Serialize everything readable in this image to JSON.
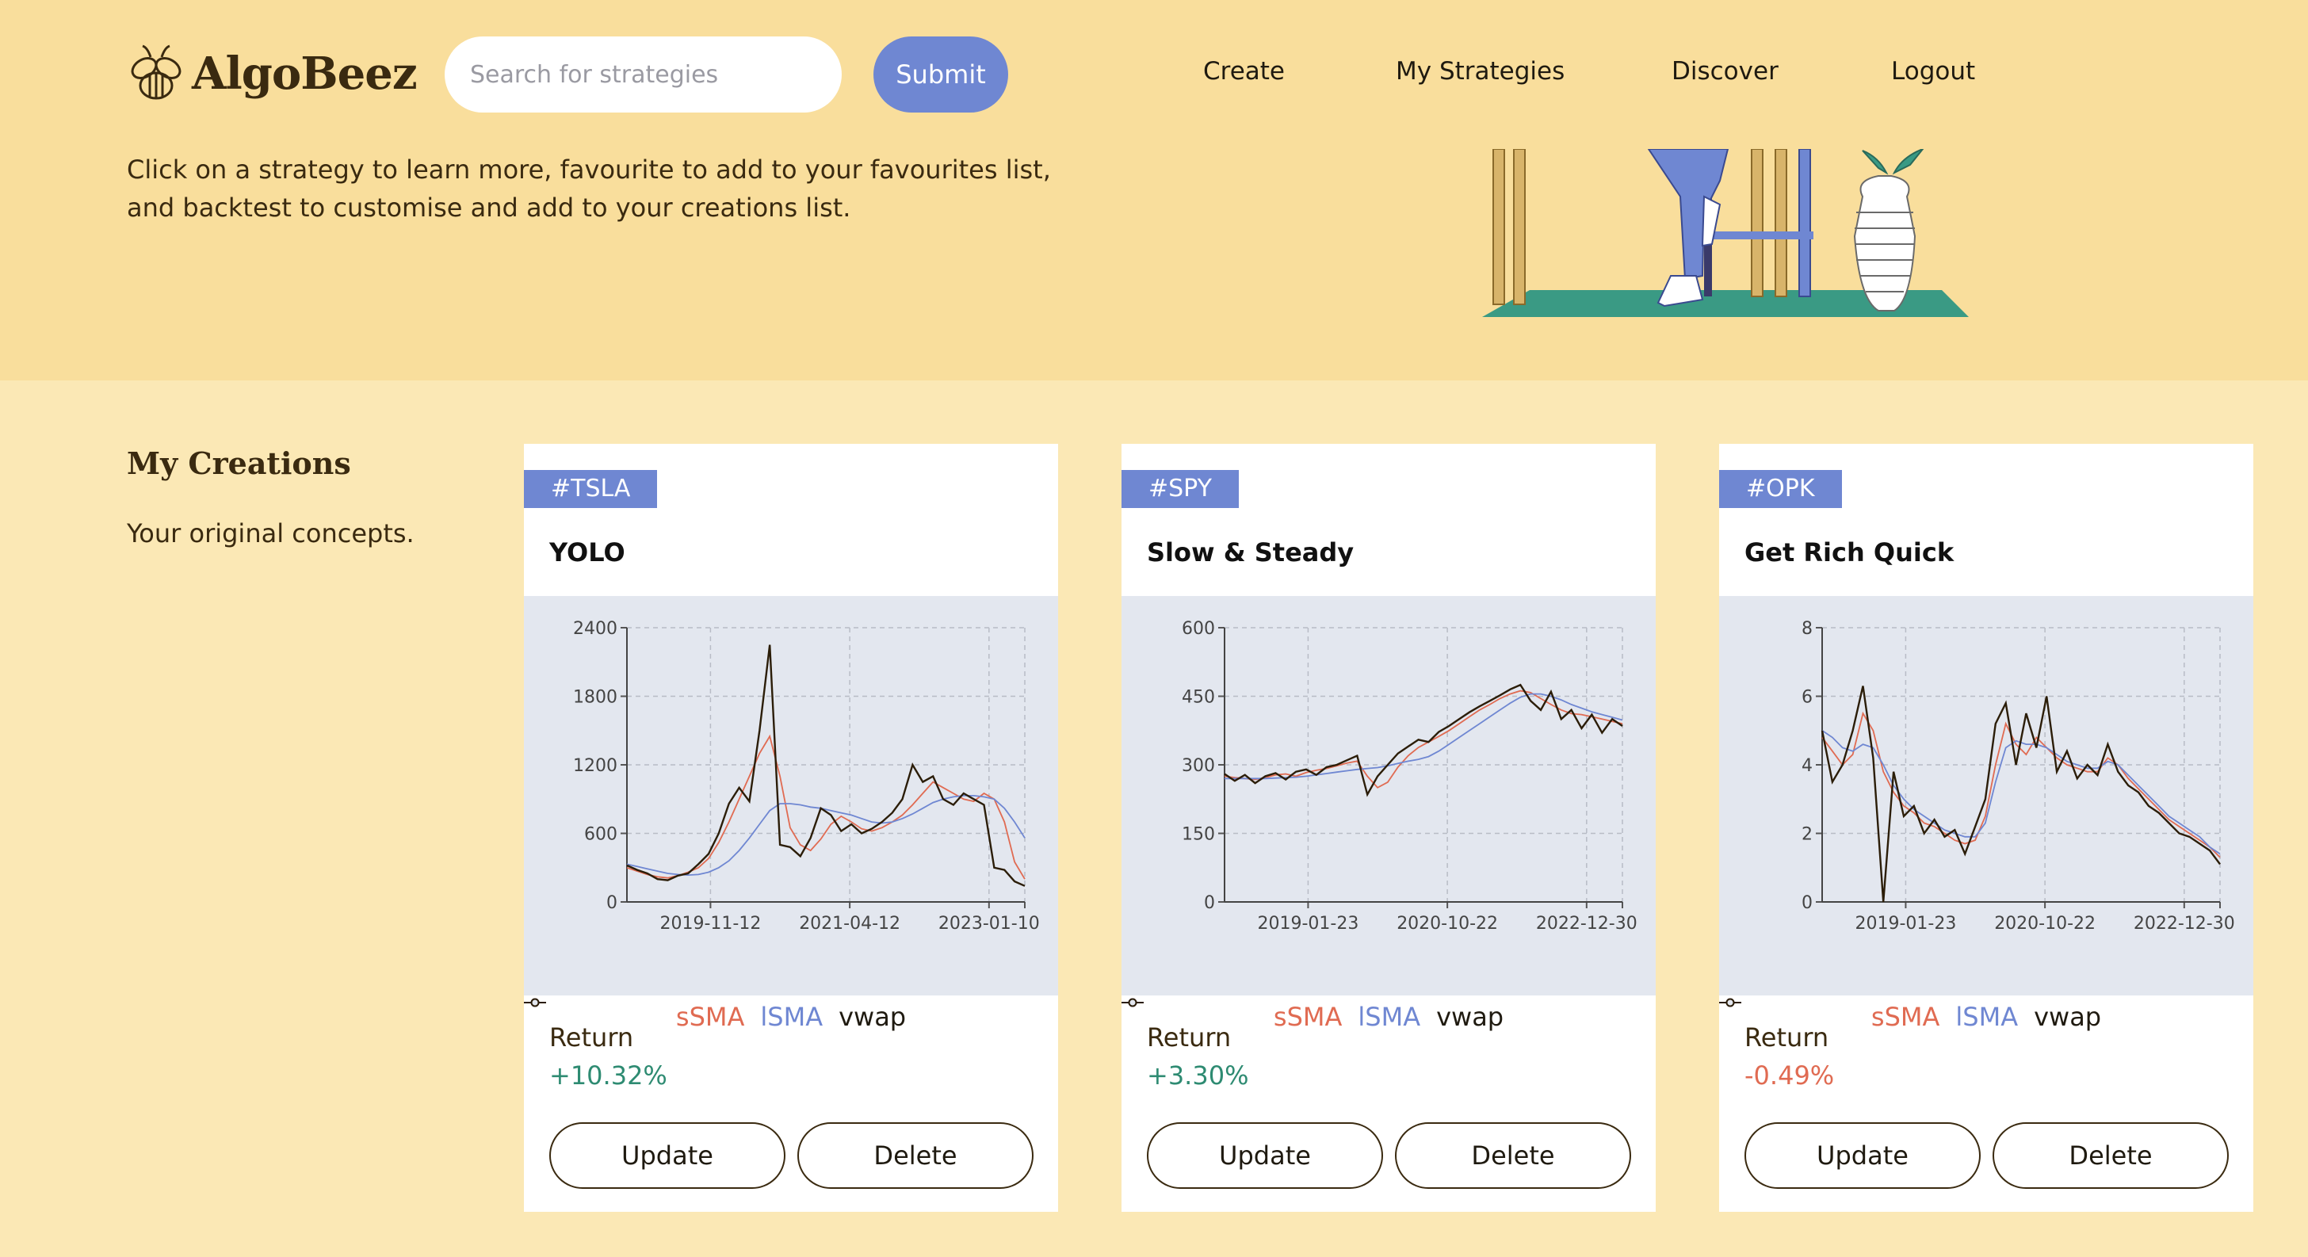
{
  "header": {
    "logo_text": "AlgoBeez",
    "search_placeholder": "Search for strategies",
    "submit_label": "Submit",
    "nav": [
      "Create",
      "My Strategies",
      "Discover",
      "Logout"
    ],
    "intro": "Click on a strategy to learn more, favourite to add to your favourites list, and backtest to customise and add to your creations list."
  },
  "section": {
    "title": "My Creations",
    "subtitle": "Your original concepts."
  },
  "cards": [
    {
      "tag": "#TSLA",
      "title": "YOLO",
      "return_label": "Return",
      "return_value": "+10.32%",
      "return_color": "#2e8b72",
      "update_label": "Update",
      "delete_label": "Delete"
    },
    {
      "tag": "#SPY",
      "title": "Slow & Steady",
      "return_label": "Return",
      "return_value": "+3.30%",
      "return_color": "#2e8b72",
      "update_label": "Update",
      "delete_label": "Delete"
    },
    {
      "tag": "#OPK",
      "title": "Get Rich Quick",
      "return_label": "Return",
      "return_value": "-0.49%",
      "return_color": "#e06b52",
      "update_label": "Update",
      "delete_label": "Delete"
    }
  ],
  "chart_data": [
    {
      "type": "line",
      "yticks": [
        "0",
        "600",
        "1200",
        "1800",
        "2400"
      ],
      "xticks": [
        "2019-11-12",
        "2021-04-12",
        "2023-01-10"
      ],
      "ylim": [
        0,
        2400
      ],
      "series": [
        {
          "name": "sSMA",
          "color": "#e06b52",
          "values": [
            300,
            270,
            240,
            220,
            210,
            230,
            260,
            300,
            380,
            520,
            700,
            900,
            1100,
            1300,
            1450,
            1100,
            650,
            500,
            450,
            550,
            680,
            750,
            700,
            640,
            620,
            650,
            700,
            760,
            850,
            950,
            1050,
            1000,
            950,
            900,
            880,
            950,
            900,
            700,
            350,
            200
          ]
        },
        {
          "name": "lSMA",
          "color": "#6f87d2",
          "values": [
            330,
            310,
            290,
            270,
            250,
            240,
            235,
            240,
            260,
            300,
            360,
            450,
            560,
            680,
            800,
            860,
            860,
            850,
            830,
            820,
            800,
            780,
            760,
            730,
            700,
            690,
            700,
            730,
            770,
            820,
            870,
            900,
            920,
            930,
            930,
            920,
            900,
            820,
            700,
            560
          ]
        },
        {
          "name": "vwap",
          "color": "#2b1d08",
          "values": [
            320,
            280,
            250,
            200,
            190,
            230,
            250,
            330,
            420,
            600,
            860,
            1000,
            880,
            1500,
            2250,
            500,
            480,
            400,
            560,
            820,
            760,
            620,
            680,
            600,
            640,
            700,
            780,
            900,
            1200,
            1050,
            1100,
            900,
            850,
            950,
            900,
            850,
            300,
            280,
            180,
            140
          ]
        }
      ]
    },
    {
      "type": "line",
      "yticks": [
        "0",
        "150",
        "300",
        "450",
        "600"
      ],
      "xticks": [
        "2019-01-23",
        "2020-10-22",
        "2022-12-30"
      ],
      "ylim": [
        0,
        600
      ],
      "series": [
        {
          "name": "sSMA",
          "color": "#e06b52",
          "values": [
            275,
            272,
            270,
            268,
            272,
            278,
            280,
            275,
            283,
            288,
            292,
            298,
            304,
            308,
            275,
            250,
            262,
            295,
            320,
            338,
            350,
            362,
            375,
            390,
            405,
            420,
            432,
            445,
            455,
            462,
            458,
            445,
            432,
            420,
            412,
            410,
            405,
            400,
            395,
            390
          ]
        },
        {
          "name": "lSMA",
          "color": "#6f87d2",
          "values": [
            270,
            270,
            270,
            270,
            270,
            271,
            272,
            273,
            275,
            278,
            281,
            284,
            287,
            290,
            292,
            294,
            298,
            303,
            308,
            312,
            318,
            330,
            345,
            360,
            375,
            390,
            405,
            420,
            435,
            448,
            455,
            455,
            450,
            442,
            432,
            424,
            416,
            410,
            404,
            398
          ]
        },
        {
          "name": "vwap",
          "color": "#2b1d08",
          "values": [
            280,
            265,
            278,
            260,
            275,
            282,
            268,
            285,
            290,
            278,
            295,
            300,
            310,
            320,
            235,
            275,
            300,
            325,
            340,
            355,
            350,
            372,
            385,
            400,
            415,
            428,
            440,
            452,
            465,
            475,
            440,
            420,
            460,
            400,
            420,
            380,
            410,
            370,
            400,
            385
          ]
        }
      ]
    },
    {
      "type": "line",
      "yticks": [
        "0",
        "2",
        "4",
        "6",
        "8"
      ],
      "xticks": [
        "2019-01-23",
        "2020-10-22",
        "2022-12-30"
      ],
      "ylim": [
        0,
        8
      ],
      "series": [
        {
          "name": "sSMA",
          "color": "#e06b52",
          "values": [
            4.8,
            4.4,
            4.0,
            4.3,
            5.5,
            5.0,
            3.8,
            3.2,
            2.8,
            2.6,
            2.3,
            2.2,
            2.0,
            1.8,
            1.7,
            1.8,
            2.5,
            4.0,
            5.2,
            4.6,
            4.3,
            4.8,
            4.5,
            4.2,
            4.0,
            3.9,
            3.8,
            3.8,
            4.2,
            4.0,
            3.6,
            3.3,
            3.0,
            2.7,
            2.4,
            2.2,
            2.0,
            1.8,
            1.6,
            1.3
          ]
        },
        {
          "name": "lSMA",
          "color": "#6f87d2",
          "values": [
            5.0,
            4.8,
            4.5,
            4.4,
            4.6,
            4.5,
            4.0,
            3.4,
            3.0,
            2.7,
            2.5,
            2.3,
            2.1,
            2.0,
            1.9,
            1.9,
            2.3,
            3.5,
            4.5,
            4.7,
            4.6,
            4.6,
            4.5,
            4.3,
            4.1,
            4.0,
            3.9,
            3.9,
            4.1,
            4.0,
            3.7,
            3.4,
            3.1,
            2.8,
            2.5,
            2.3,
            2.1,
            1.9,
            1.6,
            1.4
          ]
        },
        {
          "name": "vwap",
          "color": "#2b1d08",
          "values": [
            5.0,
            3.5,
            4.0,
            5.0,
            6.3,
            4.2,
            0.0,
            3.8,
            2.5,
            2.8,
            2.0,
            2.4,
            1.9,
            2.1,
            1.4,
            2.2,
            3.0,
            5.2,
            5.8,
            4.0,
            5.5,
            4.5,
            6.0,
            3.8,
            4.4,
            3.6,
            4.0,
            3.7,
            4.6,
            3.8,
            3.4,
            3.2,
            2.8,
            2.6,
            2.3,
            2.0,
            1.9,
            1.7,
            1.5,
            1.1
          ]
        }
      ]
    }
  ]
}
